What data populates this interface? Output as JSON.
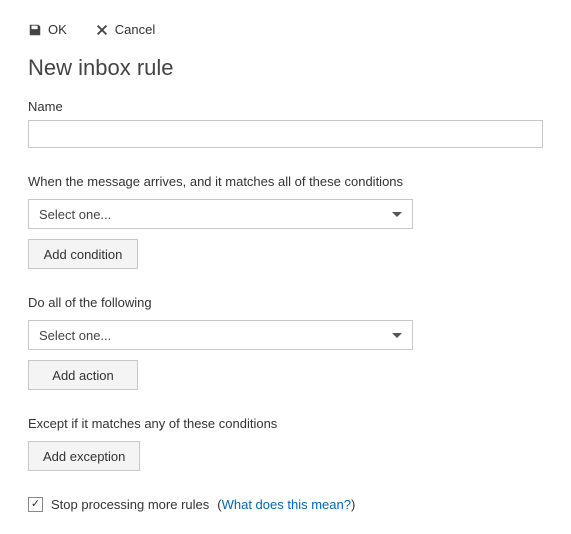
{
  "toolbar": {
    "ok_label": "OK",
    "cancel_label": "Cancel"
  },
  "page_title": "New inbox rule",
  "name_field": {
    "label": "Name",
    "value": ""
  },
  "conditions": {
    "label": "When the message arrives, and it matches all of these conditions",
    "select_placeholder": "Select one...",
    "add_button": "Add condition"
  },
  "actions": {
    "label": "Do all of the following",
    "select_placeholder": "Select one...",
    "add_button": "Add action"
  },
  "exceptions": {
    "label": "Except if it matches any of these conditions",
    "add_button": "Add exception"
  },
  "stop_processing": {
    "checked": true,
    "label": "Stop processing more rules",
    "help_text": "What does this mean?"
  }
}
